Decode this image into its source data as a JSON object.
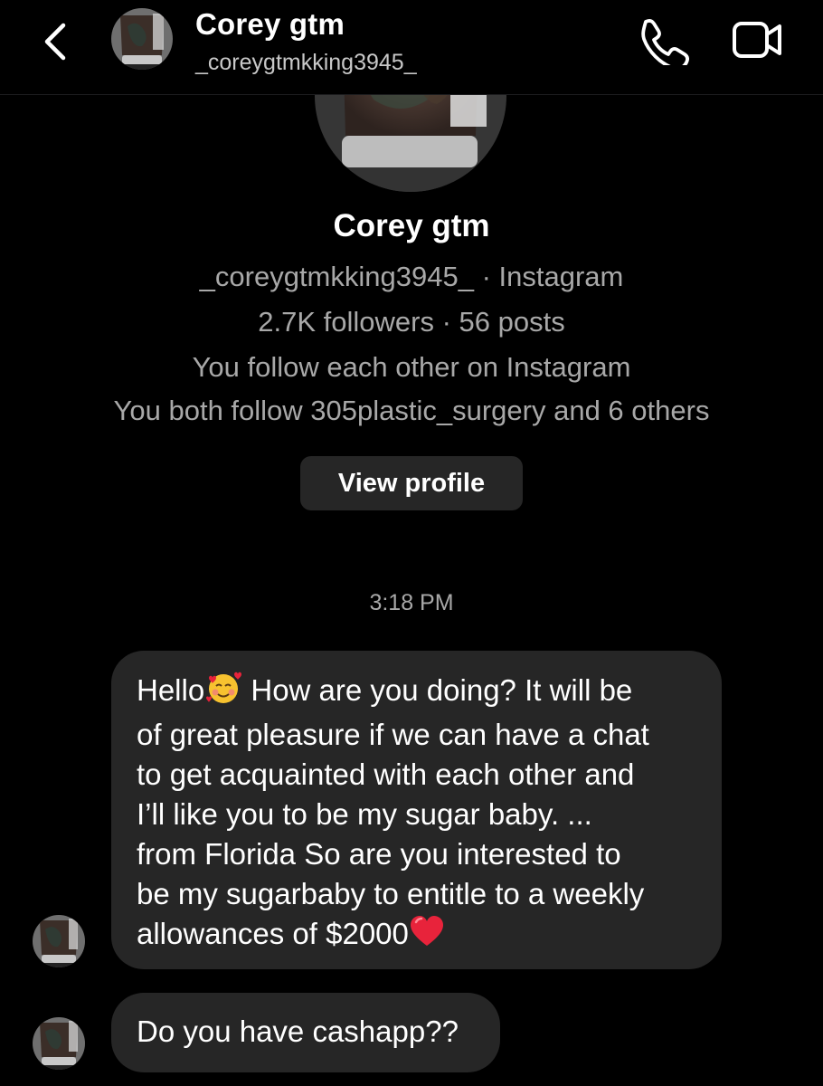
{
  "header": {
    "name": "Corey gtm",
    "username": "_coreygtmkking3945_",
    "back_icon": "chevron-left-icon",
    "call_icon": "phone-icon",
    "video_icon": "video-camera-icon"
  },
  "profile": {
    "name": "Corey gtm",
    "username_line": "_coreygtmkking3945_ · Instagram",
    "stats_line": "2.7K followers · 56 posts",
    "follow_line": "You follow each other on Instagram",
    "mutual_line": "You both follow 305plastic_surgery and 6 others",
    "view_profile_label": "View profile"
  },
  "timestamp": "3:18 PM",
  "messages": [
    {
      "lines": [
        "How are you doing? It will be",
        "of great pleasure if we can have a chat",
        "to get acquainted with each other and",
        "I’ll like you to be my sugar baby. ...",
        "from Florida So are you interested to",
        "be my sugarbaby to entitle to a weekly",
        "allowances of $2000"
      ],
      "greeting": "Hello",
      "greeting_emoji": "smiling-face-with-hearts-icon",
      "end_emoji": "red-heart-icon"
    },
    {
      "lines": [
        "Do you have cashapp??"
      ]
    }
  ],
  "colors": {
    "background": "#000000",
    "bubble": "#262626",
    "secondary_text": "#a8a8a8"
  }
}
